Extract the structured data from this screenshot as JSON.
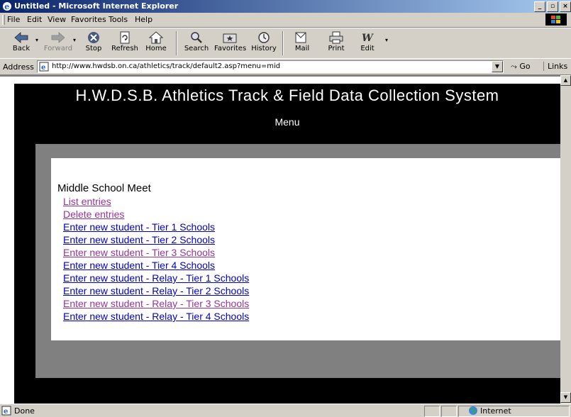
{
  "window": {
    "title": "Untitled - Microsoft Internet Explorer"
  },
  "menubar": [
    "File",
    "Edit",
    "View",
    "Favorites",
    "Tools",
    "Help"
  ],
  "toolbar": {
    "back": "Back",
    "forward": "Forward",
    "stop": "Stop",
    "refresh": "Refresh",
    "home": "Home",
    "search": "Search",
    "favorites": "Favorites",
    "history": "History",
    "mail": "Mail",
    "print": "Print",
    "edit": "Edit"
  },
  "address": {
    "label": "Address",
    "url": "http://www.hwdsb.on.ca/athletics/track/default2.asp?menu=mid",
    "go": "Go",
    "links": "Links"
  },
  "page": {
    "title": "H.W.D.S.B. Athletics Track & Field Data Collection System",
    "menu_heading": "Menu",
    "section_title": "Middle School Meet",
    "links": [
      "List entries",
      "Delete entries",
      "Enter new student - Tier 1 Schools",
      "Enter new student - Tier 2 Schools",
      "Enter new student - Tier 3 Schools",
      "Enter new student - Tier 4 Schools",
      "Enter new student - Relay - Tier 1 Schools",
      "Enter new student - Relay - Tier 2 Schools",
      "Enter new student - Relay - Tier 3 Schools",
      "Enter new student - Relay - Tier 4 Schools"
    ]
  },
  "status": {
    "text": "Done",
    "zone": "Internet"
  },
  "colors": {
    "visited_link": "#993399",
    "link": "#0000cc",
    "title_bar": "#0a246a"
  }
}
